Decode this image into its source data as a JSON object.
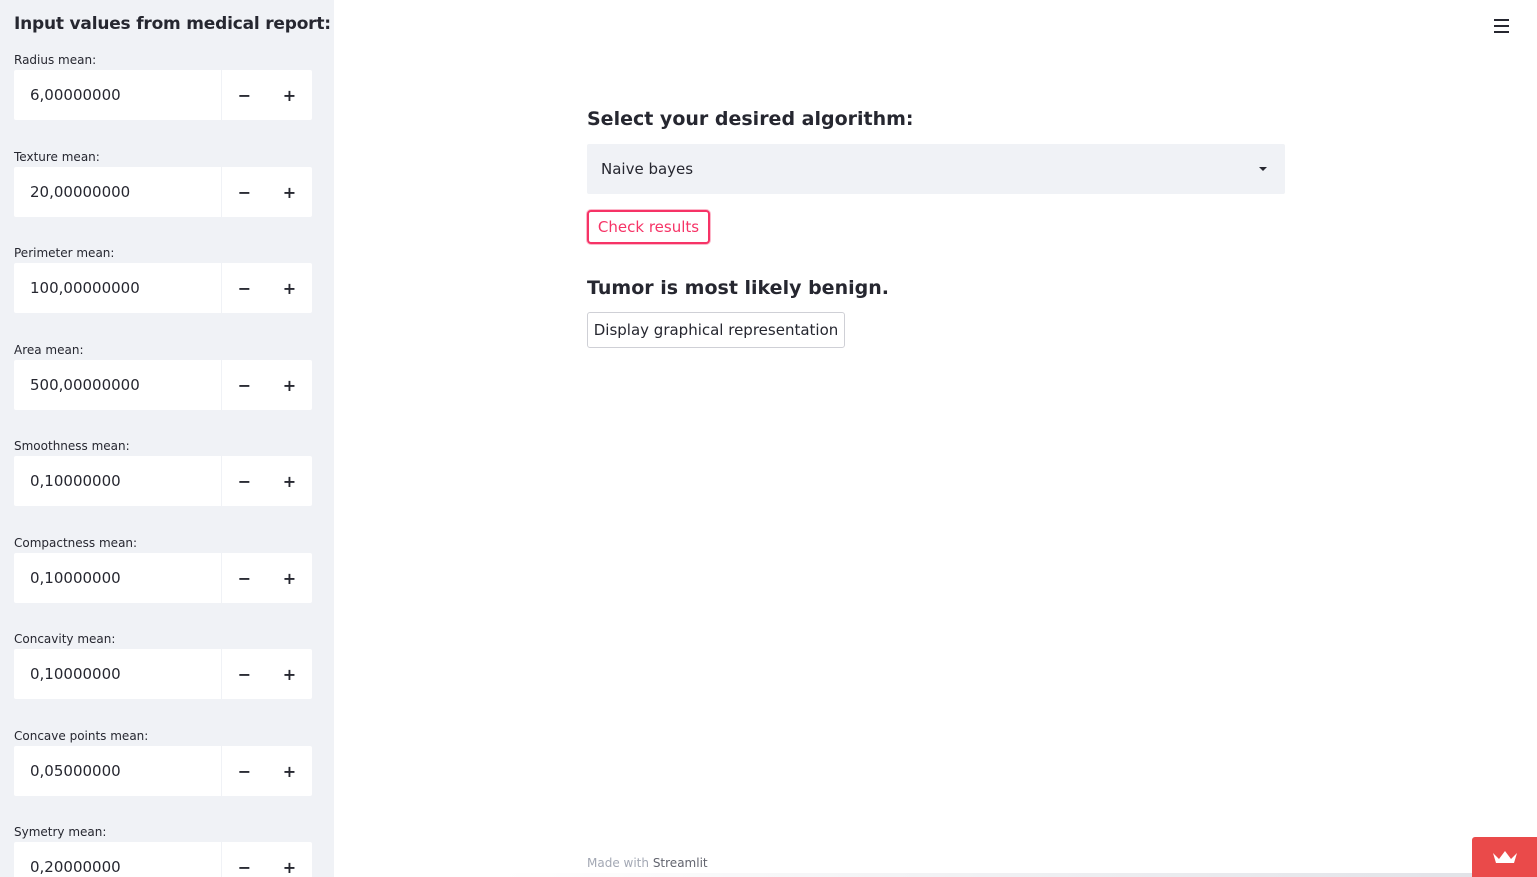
{
  "sidebar": {
    "title": "Input values from medical report:",
    "fields": [
      {
        "label": "Radius mean:",
        "value": "6,00000000"
      },
      {
        "label": "Texture mean:",
        "value": "20,00000000"
      },
      {
        "label": "Perimeter mean:",
        "value": "100,00000000"
      },
      {
        "label": "Area mean:",
        "value": "500,00000000"
      },
      {
        "label": "Smoothness mean:",
        "value": "0,10000000"
      },
      {
        "label": "Compactness mean:",
        "value": "0,10000000"
      },
      {
        "label": "Concavity mean:",
        "value": "0,10000000"
      },
      {
        "label": "Concave points mean:",
        "value": "0,05000000"
      },
      {
        "label": "Symetry mean:",
        "value": "0,20000000"
      }
    ],
    "minus_symbol": "−",
    "plus_symbol": "+"
  },
  "main": {
    "select_label": "Select your desired algorithm:",
    "selected_algorithm": "Naive bayes",
    "check_button": "Check results",
    "result": "Tumor is most likely benign.",
    "display_button": "Display graphical representation"
  },
  "footer": {
    "made_with": "Made with",
    "brand": "Streamlit"
  },
  "icons": {
    "menu": "hamburger-menu-icon",
    "badge": "crown-icon"
  },
  "colors": {
    "accent": "#f63366",
    "sidebar_bg": "#f0f2f6",
    "badge_bg": "#ea4a4a",
    "text": "#262730"
  }
}
